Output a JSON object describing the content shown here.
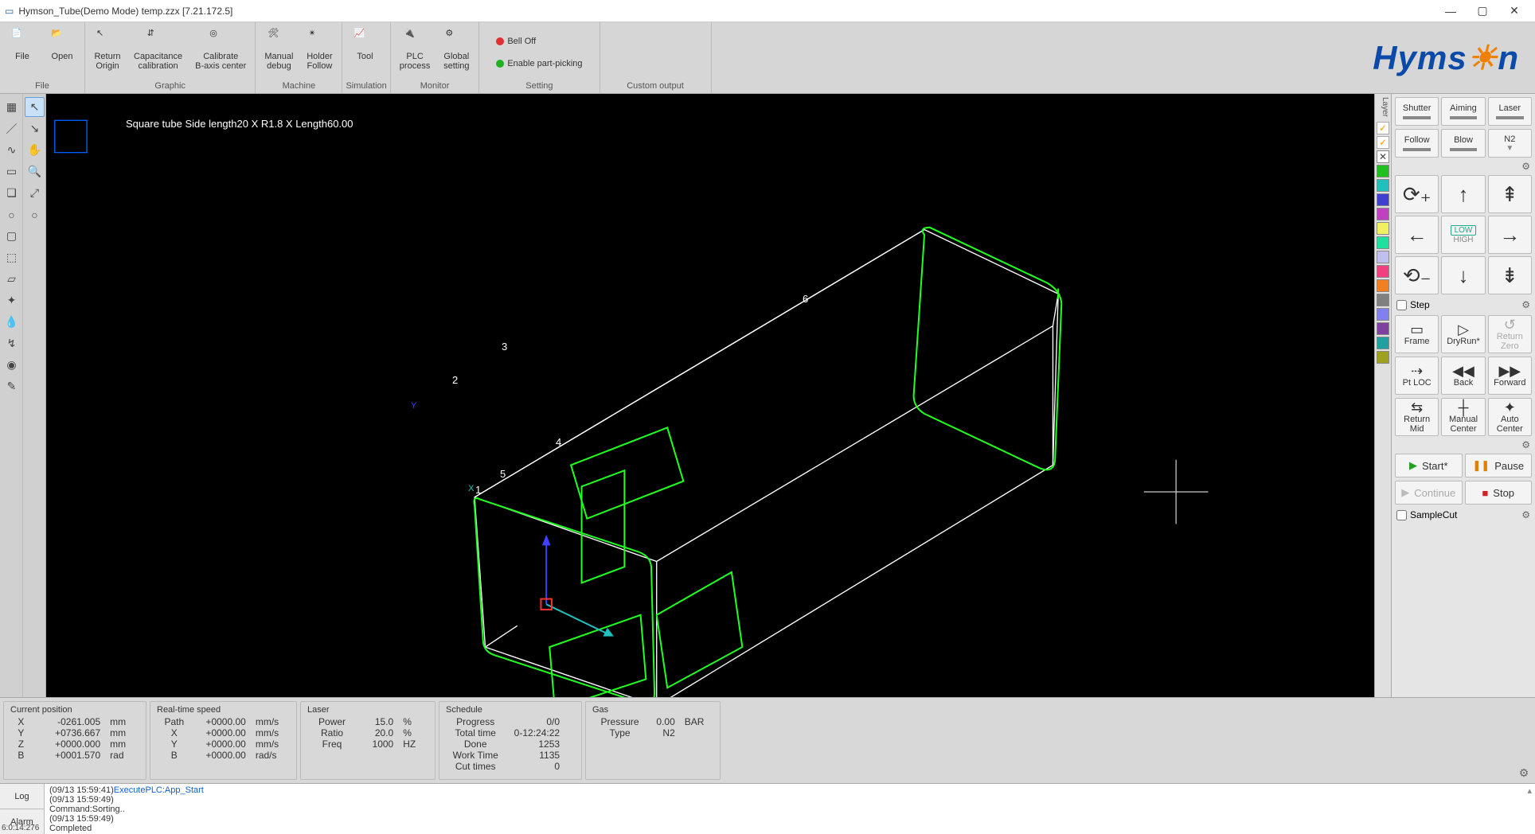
{
  "window": {
    "title": "Hymson_Tube(Demo Mode) temp.zzx  [7.21.172.5]",
    "min": "—",
    "max": "▢",
    "close": "✕"
  },
  "ribbon": {
    "file": {
      "label": "File",
      "items": [
        {
          "name": "file",
          "label": "File",
          "icon": "📄"
        },
        {
          "name": "open",
          "label": "Open",
          "icon": "📂"
        }
      ]
    },
    "graphic": {
      "label": "Graphic",
      "items": [
        {
          "name": "return-origin",
          "label": "Return\nOrigin",
          "icon": "↩"
        },
        {
          "name": "cap-cal",
          "label": "Capacitance\ncalibration",
          "icon": "⇅"
        },
        {
          "name": "cal-baxis",
          "label": "Calibrate\nB-axis center",
          "icon": "◎"
        }
      ]
    },
    "machine": {
      "label": "Machine",
      "items": [
        {
          "name": "manual-debug",
          "label": "Manual\ndebug",
          "icon": "🛠"
        },
        {
          "name": "holder-follow",
          "label": "Holder\nFollow",
          "icon": "✴"
        }
      ]
    },
    "simulation": {
      "label": "Simulation",
      "items": [
        {
          "name": "tool",
          "label": "Tool",
          "icon": "📈"
        }
      ]
    },
    "monitor": {
      "label": "Monitor",
      "items": [
        {
          "name": "plc",
          "label": "PLC\nprocess",
          "icon": "🔌"
        },
        {
          "name": "global",
          "label": "Global\nsetting",
          "icon": "⚙"
        }
      ]
    },
    "setting": {
      "label": "Setting",
      "items": [
        {
          "name": "bell",
          "label": "Bell Off",
          "dot": "#e03030"
        },
        {
          "name": "part-picking",
          "label": "Enable part-picking",
          "dot": "#20b020"
        }
      ]
    },
    "custom": {
      "label": "Custom output",
      "items": []
    }
  },
  "brand": "Hymson",
  "canvas": {
    "desc": "Square tube Side length20 X R1.8 X Length60.00",
    "nodes": [
      "1",
      "2",
      "3",
      "4",
      "5",
      "6"
    ],
    "axis_x": "X",
    "axis_y": "Y"
  },
  "layers": [
    {
      "c": "#f90",
      "t": "check"
    },
    {
      "c": "#f90",
      "t": "check"
    },
    {
      "c": "#888",
      "t": "x"
    },
    {
      "c": "#20c020"
    },
    {
      "c": "#20c0c0"
    },
    {
      "c": "#4040d0"
    },
    {
      "c": "#c040c0"
    },
    {
      "c": "#f0f060"
    },
    {
      "c": "#20e0a0"
    },
    {
      "c": "#c0c0f0"
    },
    {
      "c": "#f04080"
    },
    {
      "c": "#f08020"
    },
    {
      "c": "#808080"
    },
    {
      "c": "#8080f0"
    },
    {
      "c": "#8040a0"
    },
    {
      "c": "#20a0a0"
    },
    {
      "c": "#a0a020"
    }
  ],
  "right": {
    "row1": [
      "Shutter",
      "Aiming",
      "Laser"
    ],
    "row2": [
      "Follow",
      "Blow",
      "N2"
    ],
    "step": "Step",
    "frame": "Frame",
    "dryrun": "DryRun*",
    "retzero": "Return\nZero",
    "ptloc": "Pt LOC",
    "back": "Back",
    "forward": "Forward",
    "retmid": "Return\nMid",
    "mancenter": "Manual\nCenter",
    "autocenter": "Auto\nCenter",
    "start": "Start*",
    "pause": "Pause",
    "continue": "Continue",
    "stop": "Stop",
    "samplecut": "SampleCut",
    "low": "LOW",
    "high": "HIGH"
  },
  "status": {
    "pos": {
      "title": "Current position",
      "rows": [
        {
          "k": "X",
          "v": "-0261.005",
          "u": "mm"
        },
        {
          "k": "Y",
          "v": "+0736.667",
          "u": "mm"
        },
        {
          "k": "Z",
          "v": "+0000.000",
          "u": "mm"
        },
        {
          "k": "B",
          "v": "+0001.570",
          "u": "rad"
        }
      ]
    },
    "speed": {
      "title": "Real-time speed",
      "rows": [
        {
          "k": "Path",
          "v": "+0000.00",
          "u": "mm/s"
        },
        {
          "k": "X",
          "v": "+0000.00",
          "u": "mm/s"
        },
        {
          "k": "Y",
          "v": "+0000.00",
          "u": "mm/s"
        },
        {
          "k": "B",
          "v": "+0000.00",
          "u": "rad/s"
        }
      ]
    },
    "laser": {
      "title": "Laser",
      "rows": [
        {
          "k": "Power",
          "v": "15.0",
          "u": "%"
        },
        {
          "k": "Ratio",
          "v": "20.0",
          "u": "%"
        },
        {
          "k": "Freq",
          "v": "1000",
          "u": "HZ"
        }
      ]
    },
    "schedule": {
      "title": "Schedule",
      "rows": [
        {
          "k": "Progress",
          "v": "0/0",
          "u": ""
        },
        {
          "k": "Total time",
          "v": "0-12:24:22",
          "u": ""
        },
        {
          "k": "Done",
          "v": "1253",
          "u": ""
        },
        {
          "k": "Work Time",
          "v": "1135",
          "u": ""
        },
        {
          "k": "Cut times",
          "v": "0",
          "u": ""
        }
      ]
    },
    "gas": {
      "title": "Gas",
      "rows": [
        {
          "k": "Pressure",
          "v": "0.00",
          "u": "BAR"
        },
        {
          "k": "Type",
          "v": "N2",
          "u": ""
        }
      ]
    }
  },
  "log": {
    "tab_log": "Log",
    "tab_alarm": "Alarm",
    "lines": [
      "(09/13 15:59:41)ExecutePLC:App_Start",
      "(09/13 15:59:49)",
      "Command:Sorting..",
      "(09/13 15:59:49)",
      "Completed"
    ],
    "time": "6:0:14:276"
  }
}
